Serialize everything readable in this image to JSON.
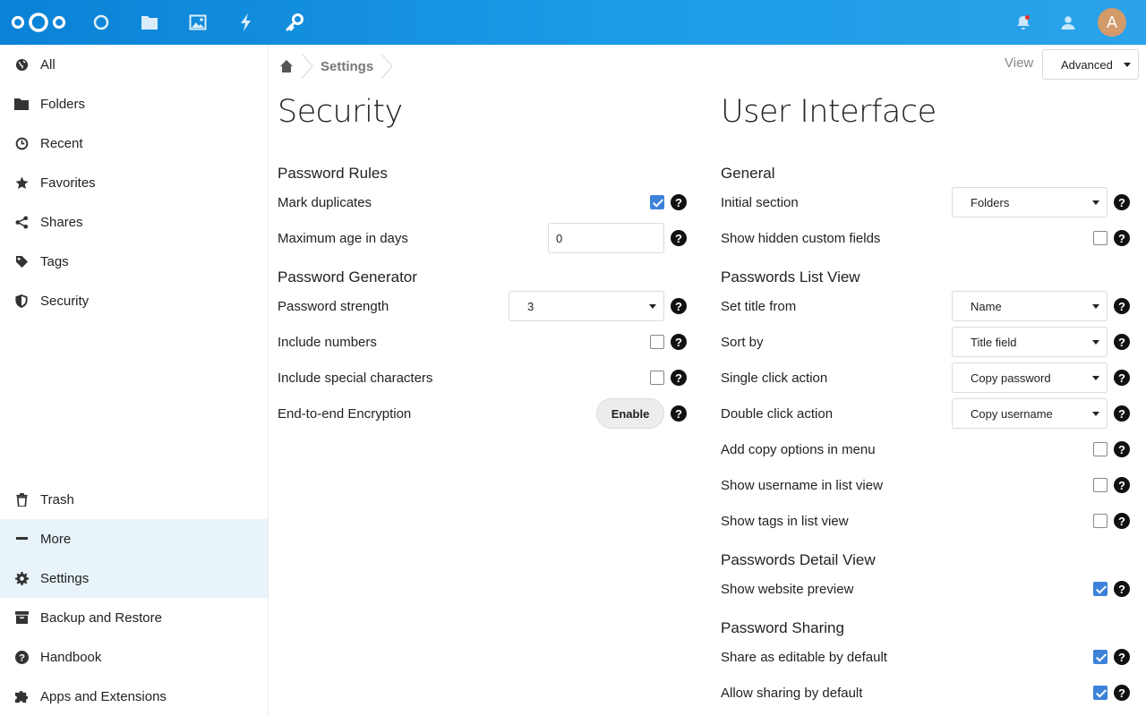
{
  "header": {
    "app_icons": [
      "dashboard-icon",
      "files-icon",
      "photos-icon",
      "activity-icon",
      "passwords-icon"
    ],
    "avatar_letter": "A",
    "brand_color": "#0a82d6"
  },
  "sidebar": {
    "items": [
      {
        "label": "All",
        "icon": "globe-icon"
      },
      {
        "label": "Folders",
        "icon": "folder-icon"
      },
      {
        "label": "Recent",
        "icon": "clock-icon"
      },
      {
        "label": "Favorites",
        "icon": "star-icon"
      },
      {
        "label": "Shares",
        "icon": "share-icon"
      },
      {
        "label": "Tags",
        "icon": "tag-icon"
      },
      {
        "label": "Security",
        "icon": "shield-icon"
      }
    ],
    "bottom_items": [
      {
        "label": "Trash",
        "icon": "trash-icon"
      },
      {
        "label": "More",
        "icon": "minus-icon"
      },
      {
        "label": "Settings",
        "icon": "gear-icon"
      },
      {
        "label": "Backup and Restore",
        "icon": "archive-icon"
      },
      {
        "label": "Handbook",
        "icon": "help-icon"
      },
      {
        "label": "Apps and Extensions",
        "icon": "puzzle-icon"
      }
    ]
  },
  "breadcrumb": {
    "current": "Settings"
  },
  "view": {
    "label": "View",
    "selected": "Advanced"
  },
  "security": {
    "title": "Security",
    "password_rules": {
      "title": "Password Rules",
      "mark_duplicates": {
        "label": "Mark duplicates",
        "checked": true
      },
      "max_age": {
        "label": "Maximum age in days",
        "value": "0"
      }
    },
    "generator": {
      "title": "Password Generator",
      "strength": {
        "label": "Password strength",
        "value": "3"
      },
      "numbers": {
        "label": "Include numbers",
        "checked": false
      },
      "special": {
        "label": "Include special characters",
        "checked": false
      },
      "e2e": {
        "label": "End-to-end Encryption",
        "button": "Enable"
      }
    }
  },
  "ui": {
    "title": "User Interface",
    "general": {
      "title": "General",
      "initial_section": {
        "label": "Initial section",
        "value": "Folders"
      },
      "hidden_fields": {
        "label": "Show hidden custom fields",
        "checked": false
      }
    },
    "list_view": {
      "title": "Passwords List View",
      "set_title": {
        "label": "Set title from",
        "value": "Name"
      },
      "sort_by": {
        "label": "Sort by",
        "value": "Title field"
      },
      "single_click": {
        "label": "Single click action",
        "value": "Copy password"
      },
      "double_click": {
        "label": "Double click action",
        "value": "Copy username"
      },
      "copy_options": {
        "label": "Add copy options in menu",
        "checked": false
      },
      "show_username": {
        "label": "Show username in list view",
        "checked": false
      },
      "show_tags": {
        "label": "Show tags in list view",
        "checked": false
      }
    },
    "detail_view": {
      "title": "Passwords Detail View",
      "website_preview": {
        "label": "Show website preview",
        "checked": true
      }
    },
    "sharing": {
      "title": "Password Sharing",
      "editable_default": {
        "label": "Share as editable by default",
        "checked": true
      },
      "allow_default": {
        "label": "Allow sharing by default",
        "checked": true
      }
    }
  },
  "help_glyph": "?"
}
